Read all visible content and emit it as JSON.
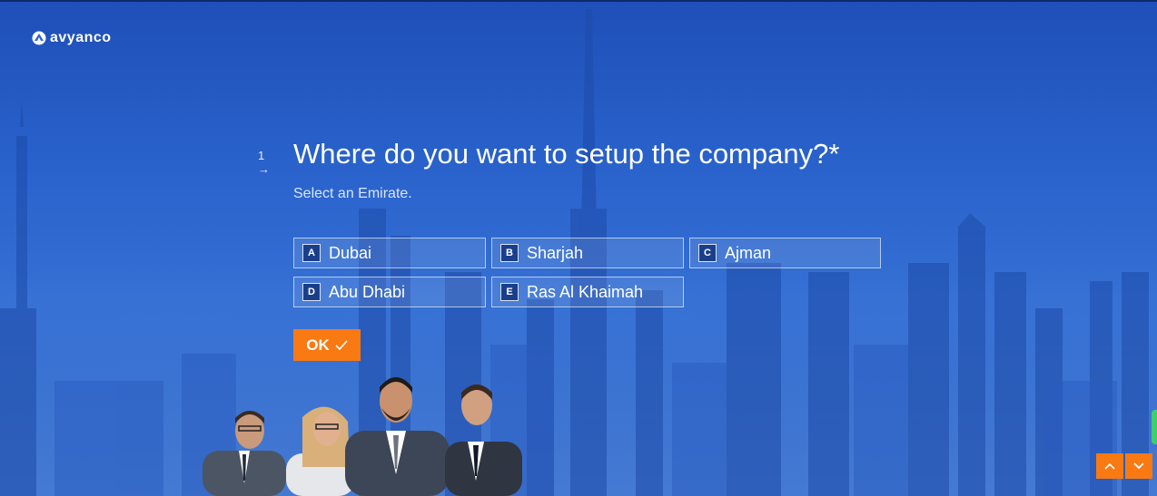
{
  "brand": {
    "name": "avyanco"
  },
  "question": {
    "number": "1",
    "arrow": "→",
    "title": "Where do you want to setup the company?*",
    "subtitle": "Select an Emirate."
  },
  "choices": [
    {
      "key": "A",
      "label": "Dubai"
    },
    {
      "key": "B",
      "label": "Sharjah"
    },
    {
      "key": "C",
      "label": "Ajman"
    },
    {
      "key": "D",
      "label": "Abu Dhabi"
    },
    {
      "key": "E",
      "label": "Ras Al Khaimah"
    }
  ],
  "ok_button": {
    "label": "OK"
  },
  "colors": {
    "accent": "#f97a12",
    "background": "#2a63cc"
  },
  "icons": {
    "ok": "check-icon",
    "prev": "chevron-up-icon",
    "next": "chevron-down-icon"
  }
}
